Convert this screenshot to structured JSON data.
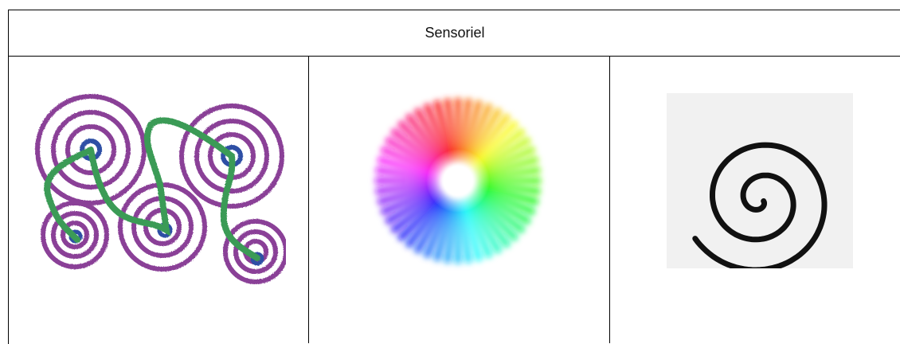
{
  "table": {
    "header": "Sensoriel"
  },
  "images": [
    {
      "icon": "spiral-circles-path-drawing"
    },
    {
      "icon": "color-wheel-burst"
    },
    {
      "icon": "black-spiral"
    }
  ]
}
